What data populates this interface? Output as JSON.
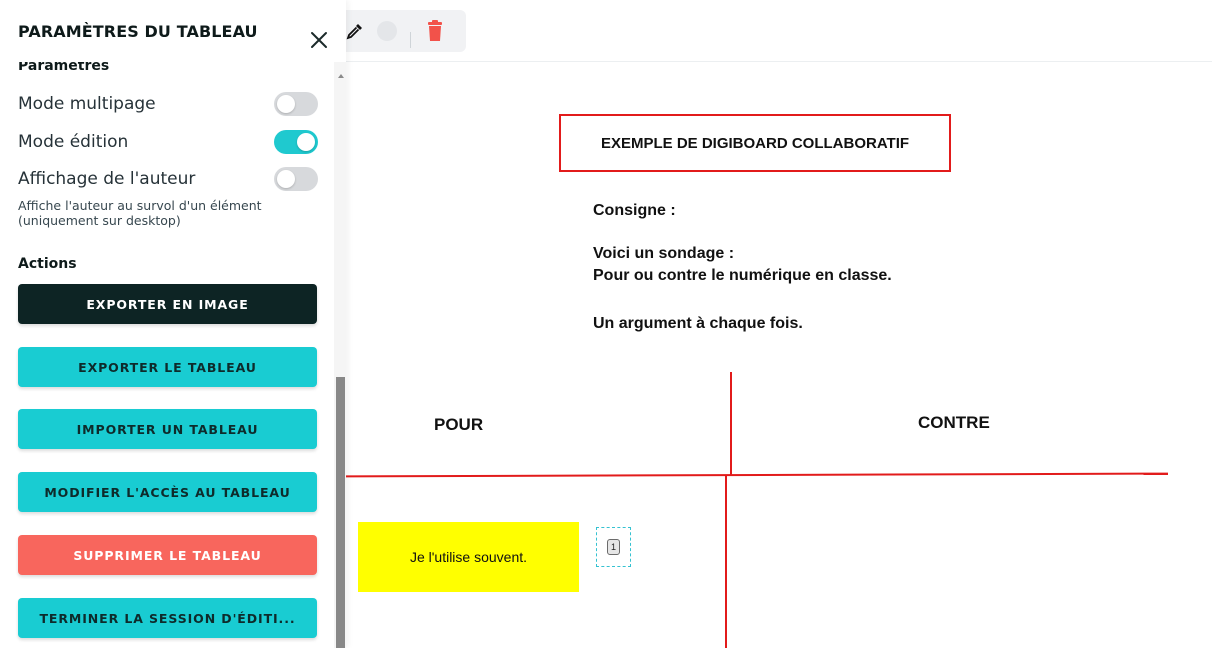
{
  "board": {
    "title": "EXEMPLE DE DIGIBOARD COLLABORATIF",
    "consigne_label": "Consigne :",
    "instruction_line1": "Voici un sondage :",
    "instruction_line2": "Pour ou contre le numérique en classe.",
    "instruction_line3": "Un argument à chaque fois.",
    "column_pour": "POUR",
    "column_contre": "CONTRE",
    "sticky_note_text": "Je l'utilise souvent.",
    "vote_count": "1"
  },
  "toolbar": {
    "icons": [
      "eyedropper-icon",
      "color-circle-icon",
      "trash-icon"
    ]
  },
  "panel": {
    "title": "PARAMÈTRES DU TABLEAU",
    "section_params": "Paramètres",
    "settings": [
      {
        "label": "Mode multipage",
        "enabled": false
      },
      {
        "label": "Mode édition",
        "enabled": true
      },
      {
        "label": "Affichage de l'auteur",
        "enabled": false
      }
    ],
    "author_hint": "Affiche l'auteur au survol d'un élément (uniquement sur desktop)",
    "actions_title": "Actions",
    "actions": [
      {
        "label": "EXPORTER EN IMAGE",
        "style": "dark"
      },
      {
        "label": "EXPORTER LE TABLEAU",
        "style": "cyan"
      },
      {
        "label": "IMPORTER UN TABLEAU",
        "style": "cyan"
      },
      {
        "label": "MODIFIER L'ACCÈS AU TABLEAU",
        "style": "cyan"
      },
      {
        "label": "SUPPRIMER LE TABLEAU",
        "style": "red"
      },
      {
        "label": "TERMINER LA SESSION D'ÉDITI...",
        "style": "cyan"
      }
    ]
  },
  "colors": {
    "accent_cyan": "#19ccd2",
    "dark_button": "#0d2424",
    "danger": "#f8665d",
    "board_lines": "#e21b1b",
    "sticky_yellow": "#ffff00"
  }
}
